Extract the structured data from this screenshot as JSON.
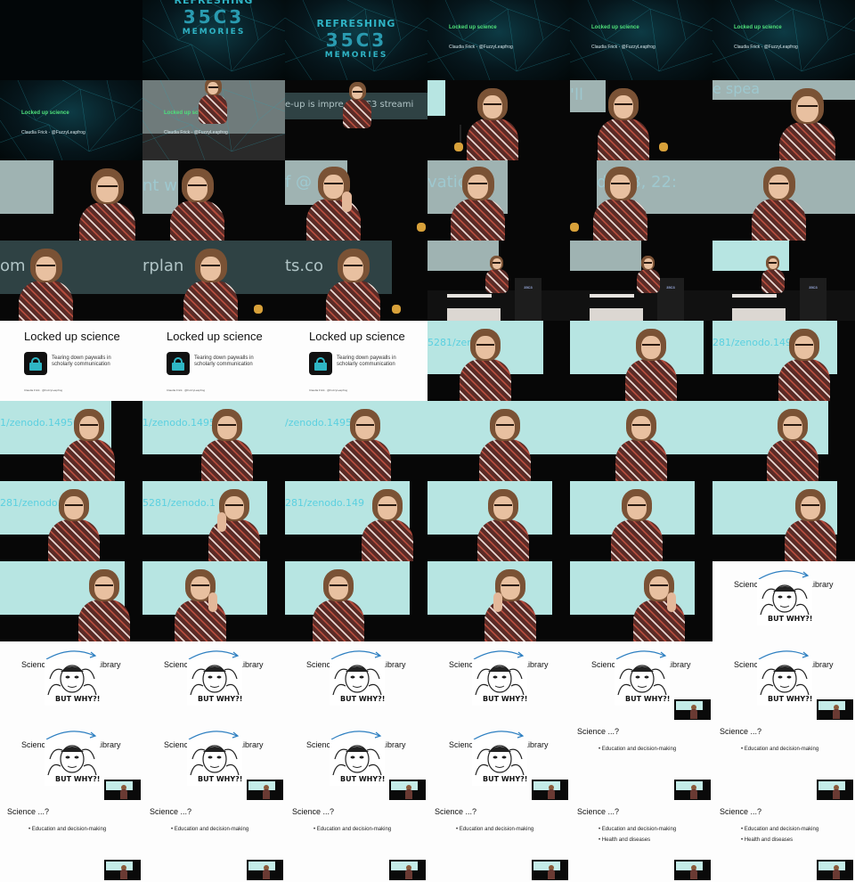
{
  "intro": {
    "logo_top": "REFRESHING",
    "logo_mid": "35C3",
    "logo_bottom": "MEMORIES",
    "talk_title": "Locked up science",
    "speaker": "Claudia Frick - @FuzzyLeapfrog"
  },
  "stage_screen_texts": {
    "t1": "e-up is impre    #35C3 streami",
    "t2": "'ll",
    "t3": "e spea",
    "t4": "nt w",
    "t5": "f @",
    "t6": "vation",
    "t7": "dec    8, 22:",
    "t8": "om EL",
    "t9": "rplan",
    "t10": "ts.co",
    "doi1": "5281/zenodo.1",
    "doi2": "281/zenodo.149",
    "doi3": "/zenodo.14956",
    "doi4": "1/zenodo.14956"
  },
  "slide_title": {
    "heading": "Locked up science",
    "sub_line1": "Tearing down paywalls in",
    "sub_line2": "scholarly communication",
    "footer_author": "Claudia Frick · @FuzzyLeapfrog"
  },
  "meme": {
    "left_label": "Science",
    "right_label": "Library",
    "caption": "BUT WHY?!"
  },
  "science_slide": {
    "heading": "Science ...?",
    "bullet1": "• Education and decision-making",
    "bullet2": "• Health and diseases"
  }
}
